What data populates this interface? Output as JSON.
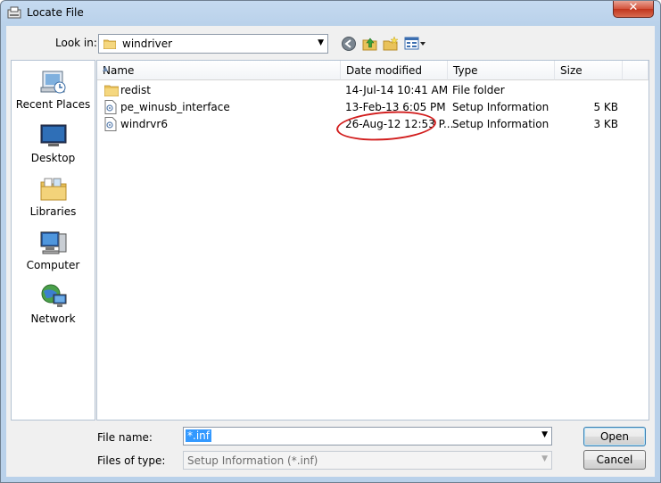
{
  "window": {
    "title": "Locate File",
    "close_glyph": "✕"
  },
  "lookin": {
    "label": "Look in:",
    "value": "windriver"
  },
  "places": [
    {
      "label": "Recent Places",
      "icon": "recent-places-icon"
    },
    {
      "label": "Desktop",
      "icon": "desktop-icon"
    },
    {
      "label": "Libraries",
      "icon": "libraries-icon"
    },
    {
      "label": "Computer",
      "icon": "computer-icon"
    },
    {
      "label": "Network",
      "icon": "network-icon"
    }
  ],
  "columns": {
    "name": "Name",
    "date": "Date modified",
    "type": "Type",
    "size": "Size"
  },
  "files": [
    {
      "name": "redist",
      "date": "14-Jul-14 10:41 AM",
      "type": "File folder",
      "size": "",
      "icon": "folder-icon"
    },
    {
      "name": "pe_winusb_interface",
      "date": "13-Feb-13 6:05 PM",
      "type": "Setup Information",
      "size": "5 KB",
      "icon": "setup-file-icon"
    },
    {
      "name": "windrvr6",
      "date": "26-Aug-12 12:53 P...",
      "type": "Setup Information",
      "size": "3 KB",
      "icon": "setup-file-icon"
    }
  ],
  "filename": {
    "label": "File name:",
    "value": "*.inf"
  },
  "filetype": {
    "label": "Files of type:",
    "value": "Setup Information (*.inf)"
  },
  "buttons": {
    "open": "Open",
    "cancel": "Cancel"
  },
  "colors": {
    "annotation": "#d21e1e",
    "title_bar": "#b9d1ea",
    "selection": "#3399ff"
  }
}
